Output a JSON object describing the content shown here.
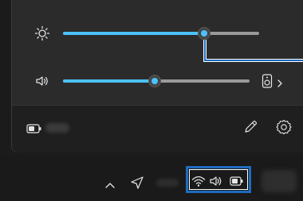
{
  "flyout": {
    "brightness": {
      "icon": "brightness-icon",
      "value_percent": 72
    },
    "volume": {
      "icon": "speaker-icon",
      "value_percent": 49,
      "output_device_icon": "speaker-output-icon",
      "expand_icon": "chevron-right-icon"
    },
    "footer": {
      "battery_icon": "battery-icon",
      "edit_icon": "pencil-icon",
      "settings_icon": "gear-icon"
    }
  },
  "taskbar": {
    "overflow_icon": "chevron-up-icon",
    "location_icon": "location-icon",
    "tray": {
      "wifi_icon": "wifi-icon",
      "volume_icon": "speaker-icon",
      "battery_icon": "battery-icon"
    }
  },
  "colors": {
    "accent": "#4cc2ff",
    "callout": "#1f6cc0",
    "track": "#9a9a9a",
    "flyout_bg": "#2b2b2b",
    "footer_bg": "#1f1f1f",
    "taskbar_bg": "#1a1a1a"
  }
}
